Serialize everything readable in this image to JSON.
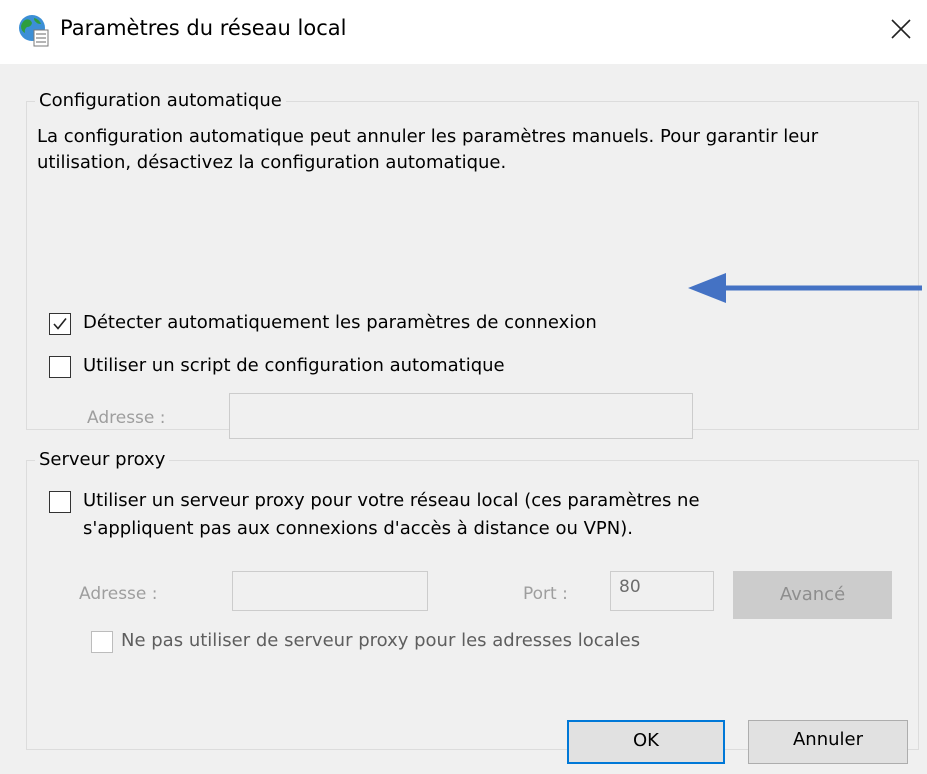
{
  "window": {
    "title": "Paramètres du réseau local",
    "icon": "globe-icon",
    "close_icon": "close-icon"
  },
  "auto_config": {
    "legend": "Configuration automatique",
    "description": "La configuration automatique peut annuler les paramètres manuels. Pour garantir leur utilisation, désactivez la configuration automatique.",
    "detect_label": "Détecter automatiquement les paramètres de connexion",
    "detect_checked": true,
    "script_label": "Utiliser un script de configuration automatique",
    "script_checked": false,
    "address_label": "Adresse :",
    "address_value": ""
  },
  "proxy": {
    "legend": "Serveur proxy",
    "use_proxy_label_line1": "Utiliser un serveur proxy pour votre réseau local (ces paramètres ne",
    "use_proxy_label_line2": "s'appliquent pas aux connexions d'accès à distance ou VPN).",
    "use_proxy_checked": false,
    "address_label": "Adresse :",
    "address_value": "",
    "port_label": "Port :",
    "port_value": "80",
    "advanced_label": "Avancé",
    "bypass_label": "Ne pas utiliser de serveur proxy pour les adresses locales",
    "bypass_checked": false
  },
  "buttons": {
    "ok": "OK",
    "cancel": "Annuler"
  },
  "colors": {
    "accent": "#0078d7",
    "annotation_arrow": "#4472c4",
    "dialog_background": "#f0f0f0"
  }
}
